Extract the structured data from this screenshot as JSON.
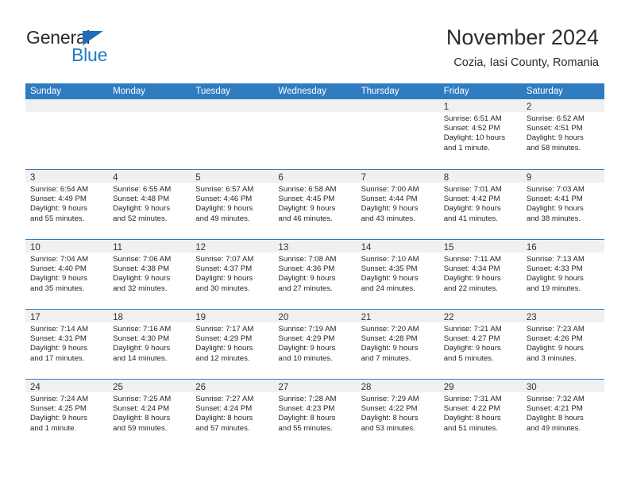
{
  "brand": {
    "name_part1": "General",
    "name_part2": "Blue",
    "accent_color": "#1d7cc4",
    "triangle_color": "#1d6fb8"
  },
  "header": {
    "title": "November 2024",
    "subtitle": "Cozia, Iasi County, Romania"
  },
  "calendar": {
    "header_bg": "#2f7cc1",
    "weekdays": [
      "Sunday",
      "Monday",
      "Tuesday",
      "Wednesday",
      "Thursday",
      "Friday",
      "Saturday"
    ],
    "weeks": [
      [
        {
          "day": "",
          "lines": []
        },
        {
          "day": "",
          "lines": []
        },
        {
          "day": "",
          "lines": []
        },
        {
          "day": "",
          "lines": []
        },
        {
          "day": "",
          "lines": []
        },
        {
          "day": "1",
          "lines": [
            "Sunrise: 6:51 AM",
            "Sunset: 4:52 PM",
            "Daylight: 10 hours",
            "and 1 minute."
          ]
        },
        {
          "day": "2",
          "lines": [
            "Sunrise: 6:52 AM",
            "Sunset: 4:51 PM",
            "Daylight: 9 hours",
            "and 58 minutes."
          ]
        }
      ],
      [
        {
          "day": "3",
          "lines": [
            "Sunrise: 6:54 AM",
            "Sunset: 4:49 PM",
            "Daylight: 9 hours",
            "and 55 minutes."
          ]
        },
        {
          "day": "4",
          "lines": [
            "Sunrise: 6:55 AM",
            "Sunset: 4:48 PM",
            "Daylight: 9 hours",
            "and 52 minutes."
          ]
        },
        {
          "day": "5",
          "lines": [
            "Sunrise: 6:57 AM",
            "Sunset: 4:46 PM",
            "Daylight: 9 hours",
            "and 49 minutes."
          ]
        },
        {
          "day": "6",
          "lines": [
            "Sunrise: 6:58 AM",
            "Sunset: 4:45 PM",
            "Daylight: 9 hours",
            "and 46 minutes."
          ]
        },
        {
          "day": "7",
          "lines": [
            "Sunrise: 7:00 AM",
            "Sunset: 4:44 PM",
            "Daylight: 9 hours",
            "and 43 minutes."
          ]
        },
        {
          "day": "8",
          "lines": [
            "Sunrise: 7:01 AM",
            "Sunset: 4:42 PM",
            "Daylight: 9 hours",
            "and 41 minutes."
          ]
        },
        {
          "day": "9",
          "lines": [
            "Sunrise: 7:03 AM",
            "Sunset: 4:41 PM",
            "Daylight: 9 hours",
            "and 38 minutes."
          ]
        }
      ],
      [
        {
          "day": "10",
          "lines": [
            "Sunrise: 7:04 AM",
            "Sunset: 4:40 PM",
            "Daylight: 9 hours",
            "and 35 minutes."
          ]
        },
        {
          "day": "11",
          "lines": [
            "Sunrise: 7:06 AM",
            "Sunset: 4:38 PM",
            "Daylight: 9 hours",
            "and 32 minutes."
          ]
        },
        {
          "day": "12",
          "lines": [
            "Sunrise: 7:07 AM",
            "Sunset: 4:37 PM",
            "Daylight: 9 hours",
            "and 30 minutes."
          ]
        },
        {
          "day": "13",
          "lines": [
            "Sunrise: 7:08 AM",
            "Sunset: 4:36 PM",
            "Daylight: 9 hours",
            "and 27 minutes."
          ]
        },
        {
          "day": "14",
          "lines": [
            "Sunrise: 7:10 AM",
            "Sunset: 4:35 PM",
            "Daylight: 9 hours",
            "and 24 minutes."
          ]
        },
        {
          "day": "15",
          "lines": [
            "Sunrise: 7:11 AM",
            "Sunset: 4:34 PM",
            "Daylight: 9 hours",
            "and 22 minutes."
          ]
        },
        {
          "day": "16",
          "lines": [
            "Sunrise: 7:13 AM",
            "Sunset: 4:33 PM",
            "Daylight: 9 hours",
            "and 19 minutes."
          ]
        }
      ],
      [
        {
          "day": "17",
          "lines": [
            "Sunrise: 7:14 AM",
            "Sunset: 4:31 PM",
            "Daylight: 9 hours",
            "and 17 minutes."
          ]
        },
        {
          "day": "18",
          "lines": [
            "Sunrise: 7:16 AM",
            "Sunset: 4:30 PM",
            "Daylight: 9 hours",
            "and 14 minutes."
          ]
        },
        {
          "day": "19",
          "lines": [
            "Sunrise: 7:17 AM",
            "Sunset: 4:29 PM",
            "Daylight: 9 hours",
            "and 12 minutes."
          ]
        },
        {
          "day": "20",
          "lines": [
            "Sunrise: 7:19 AM",
            "Sunset: 4:29 PM",
            "Daylight: 9 hours",
            "and 10 minutes."
          ]
        },
        {
          "day": "21",
          "lines": [
            "Sunrise: 7:20 AM",
            "Sunset: 4:28 PM",
            "Daylight: 9 hours",
            "and 7 minutes."
          ]
        },
        {
          "day": "22",
          "lines": [
            "Sunrise: 7:21 AM",
            "Sunset: 4:27 PM",
            "Daylight: 9 hours",
            "and 5 minutes."
          ]
        },
        {
          "day": "23",
          "lines": [
            "Sunrise: 7:23 AM",
            "Sunset: 4:26 PM",
            "Daylight: 9 hours",
            "and 3 minutes."
          ]
        }
      ],
      [
        {
          "day": "24",
          "lines": [
            "Sunrise: 7:24 AM",
            "Sunset: 4:25 PM",
            "Daylight: 9 hours",
            "and 1 minute."
          ]
        },
        {
          "day": "25",
          "lines": [
            "Sunrise: 7:25 AM",
            "Sunset: 4:24 PM",
            "Daylight: 8 hours",
            "and 59 minutes."
          ]
        },
        {
          "day": "26",
          "lines": [
            "Sunrise: 7:27 AM",
            "Sunset: 4:24 PM",
            "Daylight: 8 hours",
            "and 57 minutes."
          ]
        },
        {
          "day": "27",
          "lines": [
            "Sunrise: 7:28 AM",
            "Sunset: 4:23 PM",
            "Daylight: 8 hours",
            "and 55 minutes."
          ]
        },
        {
          "day": "28",
          "lines": [
            "Sunrise: 7:29 AM",
            "Sunset: 4:22 PM",
            "Daylight: 8 hours",
            "and 53 minutes."
          ]
        },
        {
          "day": "29",
          "lines": [
            "Sunrise: 7:31 AM",
            "Sunset: 4:22 PM",
            "Daylight: 8 hours",
            "and 51 minutes."
          ]
        },
        {
          "day": "30",
          "lines": [
            "Sunrise: 7:32 AM",
            "Sunset: 4:21 PM",
            "Daylight: 8 hours",
            "and 49 minutes."
          ]
        }
      ]
    ]
  }
}
